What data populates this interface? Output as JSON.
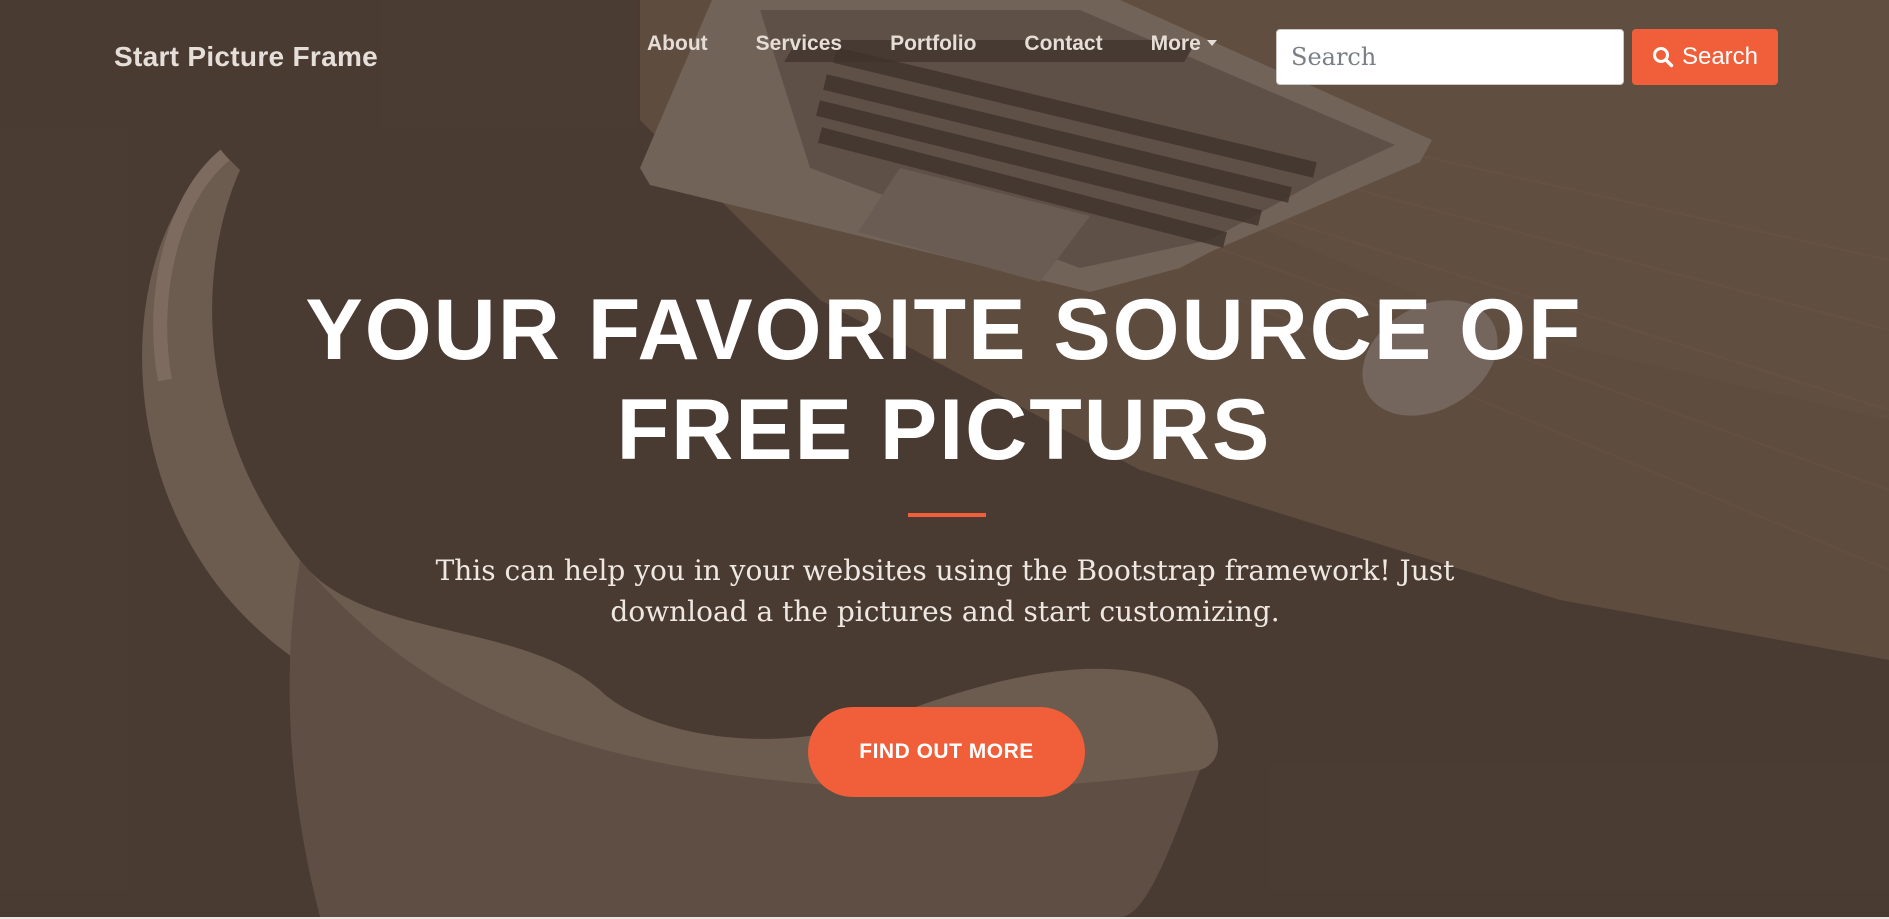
{
  "navbar": {
    "brand": "Start Picture Frame",
    "items": [
      {
        "label": "About"
      },
      {
        "label": "Services"
      },
      {
        "label": "Portfolio"
      },
      {
        "label": "Contact"
      },
      {
        "label": "More"
      }
    ],
    "search": {
      "placeholder": "Search",
      "value": ""
    },
    "search_button_label": "Search"
  },
  "hero": {
    "headline": "YOUR FAVORITE SOURCE OF FREE PICTURS",
    "subtext": "This can help you in your websites using the Bootstrap framework! Just download a the pictures and start customizing.",
    "cta_label": "FIND OUT MORE"
  },
  "icons": {
    "search_button_icon": "search-icon",
    "more_dropdown_icon": "caret-down-icon"
  },
  "colors": {
    "accent": "#f05f39",
    "overlay": "#4e4138",
    "text_light": "#ffffff"
  }
}
